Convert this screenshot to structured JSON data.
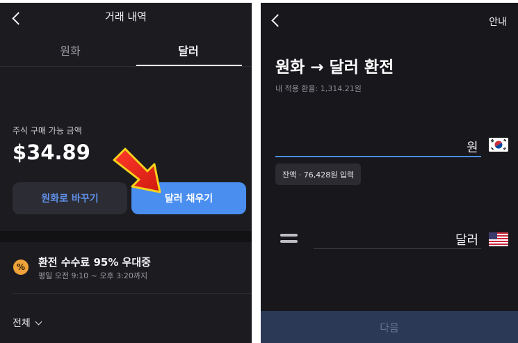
{
  "left": {
    "header": {
      "title": "거래 내역"
    },
    "tabs": [
      {
        "label": "원화",
        "active": false
      },
      {
        "label": "달러",
        "active": true
      }
    ],
    "available": {
      "label": "주식 구매 가능 금액",
      "amount": "$34.89"
    },
    "buttons": {
      "to_krw": "원화로 바꾸기",
      "fill_usd": "달러 채우기"
    },
    "promo": {
      "icon_text": "%",
      "title": "환전 수수료 95% 우대중",
      "subtitle": "평일 오전 9:10 ~ 오후 3:20까지"
    },
    "filter": {
      "label": "전체"
    }
  },
  "right": {
    "header": {
      "help": "안내"
    },
    "title": "원화 → 달러 환전",
    "rate": "내 적용 환율: 1,314.21원",
    "krw_field": {
      "value": "",
      "unit": "원"
    },
    "balance_chip": "잔액 · 76,428원 입력",
    "usd_field": {
      "value": "",
      "unit": "달러"
    },
    "next_button": "다음"
  },
  "colors": {
    "accent": "#4a8ef0",
    "promo": "#f0a23a",
    "arrow": "#e8281c"
  },
  "icons": [
    "back-arrow-icon",
    "red-arrow-icon",
    "percent-icon",
    "chevron-down-icon",
    "korea-flag-icon",
    "us-flag-icon",
    "equals-icon"
  ]
}
